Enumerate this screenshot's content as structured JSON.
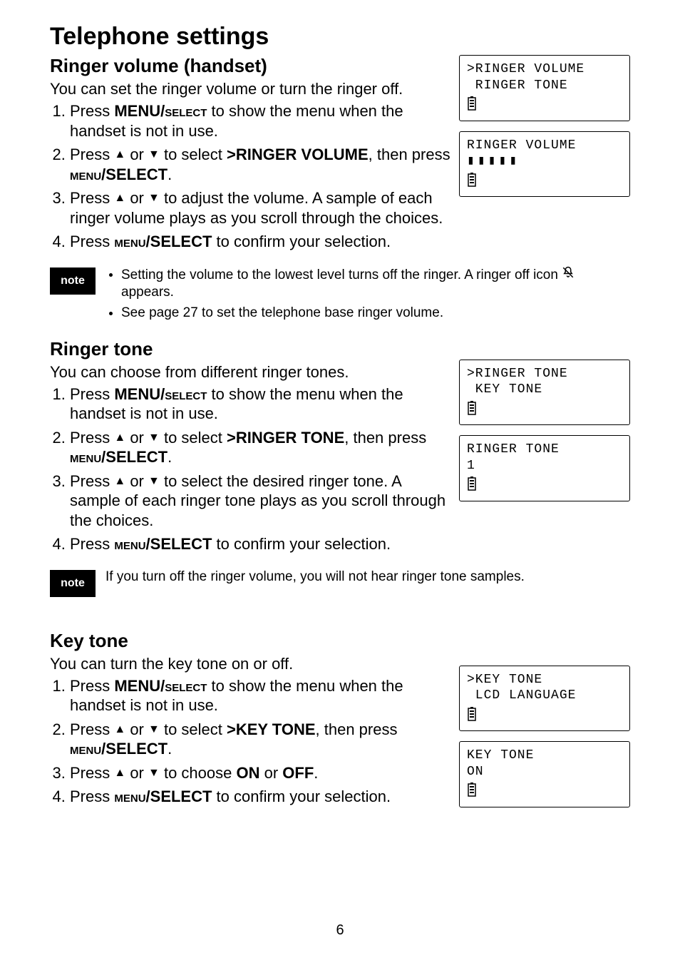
{
  "title": "Telephone settings",
  "page_number": "6",
  "note_label": "note",
  "sections": [
    {
      "id": "ringer_volume",
      "heading": "Ringer volume (handset)",
      "intro": "You can set the ringer volume or turn the ringer off.",
      "steps": [
        {
          "prefix": "Press ",
          "bold1": "MENU/",
          "sc1": "SELECT",
          "suffix": " to show the menu when the handset is not in use."
        },
        {
          "prefix": "Press ",
          "up": true,
          "mid1": " or ",
          "down": true,
          "mid2": " to select ",
          "bold1": ">RINGER VOLUME",
          "mid3": ", then press ",
          "sc2": "MENU",
          "bold2": "/SELECT",
          "suffix": "."
        },
        {
          "prefix": "Press ",
          "up": true,
          "mid1": " or ",
          "down": true,
          "suffix": " to adjust the volume. A sample of each ringer volume plays as you scroll through the choices."
        },
        {
          "prefix": "Press ",
          "sc2": "MENU",
          "bold2": "/SELECT",
          "suffix": " to confirm your selection."
        }
      ],
      "screens": [
        {
          "line1": ">RINGER VOLUME",
          "line2": " RINGER TONE",
          "batt": true
        },
        {
          "line1": "RINGER VOLUME",
          "bars": "▮▮▮▮▮",
          "batt": true
        }
      ],
      "note": {
        "type": "list",
        "items": [
          {
            "t1": "Setting the volume to the lowest level turns off the ringer. A ringer off icon ",
            "bell": true,
            "t2": " appears."
          },
          {
            "t1": "See page 27 to set the telephone base ringer volume."
          }
        ]
      }
    },
    {
      "id": "ringer_tone",
      "heading": "Ringer tone",
      "intro": "You can choose from different ringer tones.",
      "steps": [
        {
          "prefix": "Press ",
          "bold1": "MENU/",
          "sc1": "SELECT",
          "suffix": " to show the menu when the handset is not in use."
        },
        {
          "prefix": "Press ",
          "up": true,
          "mid1": " or ",
          "down": true,
          "mid2": " to select ",
          "bold1": ">RINGER TONE",
          "mid3": ", then press ",
          "sc2": "MENU",
          "bold2": "/SELECT",
          "suffix": "."
        },
        {
          "prefix": "Press ",
          "up": true,
          "mid1": " or ",
          "down": true,
          "suffix": " to select the desired ringer tone. A sample of each ringer tone plays as you scroll through the choices."
        },
        {
          "prefix": "Press ",
          "sc2": "MENU",
          "bold2": "/SELECT",
          "suffix": " to confirm your selection."
        }
      ],
      "screens": [
        {
          "line1": ">RINGER TONE",
          "line2": " KEY TONE",
          "batt": true
        },
        {
          "line1": "RINGER TONE",
          "line2": "1",
          "batt": true
        }
      ],
      "note": {
        "type": "text",
        "text": "If you turn off the ringer volume, you will not hear ringer tone samples."
      }
    },
    {
      "id": "key_tone",
      "heading": "Key tone",
      "intro": "You can turn the key tone on or off.",
      "steps": [
        {
          "prefix": "Press ",
          "bold1": "MENU/",
          "sc1": "SELECT",
          "suffix": " to show the menu when the handset is not in use."
        },
        {
          "prefix": "Press ",
          "up": true,
          "mid1": " or ",
          "down": true,
          "mid2": " to select ",
          "bold1": ">KEY TONE",
          "mid3": ", then press ",
          "sc2": "MENU",
          "bold2": "/SELECT",
          "suffix": "."
        },
        {
          "prefix": "Press ",
          "up": true,
          "mid1": " or ",
          "down": true,
          "mid2": " to choose ",
          "bold1": "ON",
          "mid3": " or ",
          "bold2": "OFF",
          "suffix": "."
        },
        {
          "prefix": "Press ",
          "sc2": "MENU",
          "bold2": "/SELECT",
          "suffix": " to confirm your selection."
        }
      ],
      "screens": [
        {
          "line1": ">KEY TONE",
          "line2": " LCD LANGUAGE",
          "batt": true
        },
        {
          "line1": "KEY TONE",
          "line2": "ON",
          "batt": true
        }
      ]
    }
  ]
}
